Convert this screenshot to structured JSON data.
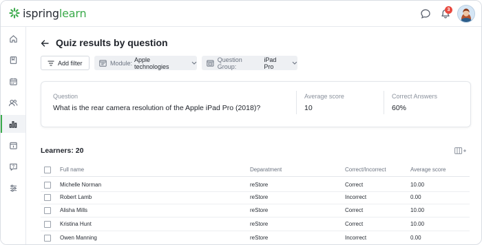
{
  "app": {
    "logo_part1": "ispring",
    "logo_part2": "learn",
    "notifications_count": "3"
  },
  "sidebar": {
    "items": [
      {
        "icon": "home-icon"
      },
      {
        "icon": "book-icon"
      },
      {
        "icon": "calendar-icon"
      },
      {
        "icon": "users-icon"
      },
      {
        "icon": "reports-icon",
        "active": true
      },
      {
        "icon": "info-calendar-icon"
      },
      {
        "icon": "question-icon"
      },
      {
        "icon": "settings-sliders-icon"
      }
    ]
  },
  "page": {
    "title": "Quiz results by question"
  },
  "filters": {
    "add_filter_label": "Add filter",
    "module": {
      "label": "Module:",
      "value": "Apple technologies"
    },
    "question_group": {
      "label": "Question Group:",
      "value": "iPad Pro"
    }
  },
  "summary": {
    "question_label": "Question",
    "question_text": "What is the rear camera resolution of the Apple iPad Pro (2018)?",
    "avg_label": "Average score",
    "avg_value": "10",
    "correct_label": "Correct Answers",
    "correct_value": "60%"
  },
  "learners": {
    "title": "Learners: 20"
  },
  "table": {
    "headers": {
      "name": "Full name",
      "dept": "Deparatment",
      "correct": "Correct/Incorrect",
      "avg": "Average score"
    },
    "rows": [
      {
        "name": "Michelle Norman",
        "dept": "reStore",
        "correct": "Correct",
        "avg": "10.00"
      },
      {
        "name": "Robert Lamb",
        "dept": "reStore",
        "correct": "Incorrect",
        "avg": "0.00"
      },
      {
        "name": "Alisha Mills",
        "dept": "reStore",
        "correct": "Correct",
        "avg": "10.00"
      },
      {
        "name": "Kristina Hunt",
        "dept": "reStore",
        "correct": "Correct",
        "avg": "10.00"
      },
      {
        "name": "Owen Manning",
        "dept": "reStore",
        "correct": "Incorrect",
        "avg": "0.00"
      }
    ]
  },
  "colors": {
    "brand_green": "#3aaa4a",
    "badge_red": "#e8493f"
  }
}
